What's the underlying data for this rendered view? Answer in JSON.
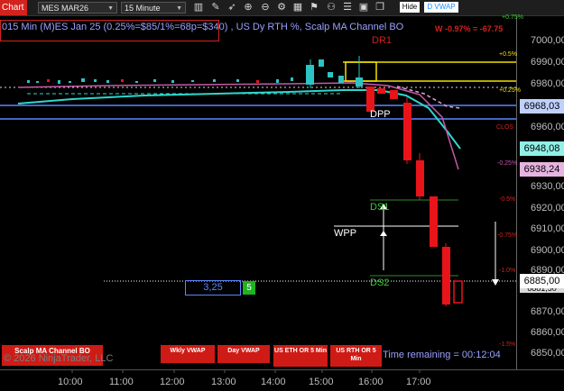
{
  "toolbar": {
    "chart_tab": "Chart",
    "instrument": "MES MAR26",
    "interval": "15 Minute",
    "icons": [
      "bar-type-icon",
      "draw-icon",
      "magnify-icon",
      "zoom-in-icon",
      "zoom-out-icon",
      "properties-icon",
      "grid-icon",
      "indicators-icon",
      "strategy-icon",
      "list-icon"
    ],
    "hide_label": "Hide",
    "dvwap_label": "D VWAP"
  },
  "chart": {
    "title": "015 Min (M)ES Jan 25 (0.25%=$85/1%=68p=$340) , US Dy RTH %, Scalp MA Channel BO",
    "pnl": "W -0.97% = -67.75",
    "dr1": "DR1",
    "dpp": "DPP",
    "wpp": "WPP",
    "ds1": "DS1",
    "ds2": "DS2",
    "close_label": "CLOS",
    "spread_value": "3,25",
    "spread_count": "5",
    "copyright": "© 2026 NinjaTrader, LLC",
    "time_remaining": "Time remaining = 00:12:04",
    "pct_labels": [
      "+0.75%",
      "+0.5%",
      "+0.25%",
      "-0.25%",
      "-0.5%",
      "-0.75%",
      "-1.0%",
      "-1.5%"
    ],
    "price_ticks": [
      "7000,00",
      "6990,00",
      "6980,00",
      "6960,00",
      "6930,00",
      "6920,00",
      "6910,00",
      "6900,00",
      "6890,00",
      "6870,00",
      "6860,00",
      "6850,00"
    ],
    "price_boxes": {
      "a": "6968,03",
      "b": "6948,08",
      "c": "6938,24",
      "d": "6885,00",
      "e": "6881,50"
    },
    "time_ticks": [
      "10:00",
      "11:00",
      "12:00",
      "13:00",
      "14:00",
      "15:00",
      "16:00",
      "17:00"
    ]
  },
  "buttons": {
    "scalp": "Scalp MA Channel BO",
    "wkly_vwap": "Wkly VWAP",
    "day_vwap": "Day VWAP",
    "us_eth": "US ETH OR 5 Min",
    "us_rth": "US RTH OR 5 Min"
  },
  "colors": {
    "accent_red": "#d2231e",
    "price_blue": "#5a86ff",
    "title_blue": "#9aa0ff",
    "level_yellow": "#f0e000",
    "ma_cyan": "#2fd6cc",
    "candle_up": "#2cc4c4",
    "candle_down": "#e8141a"
  }
}
